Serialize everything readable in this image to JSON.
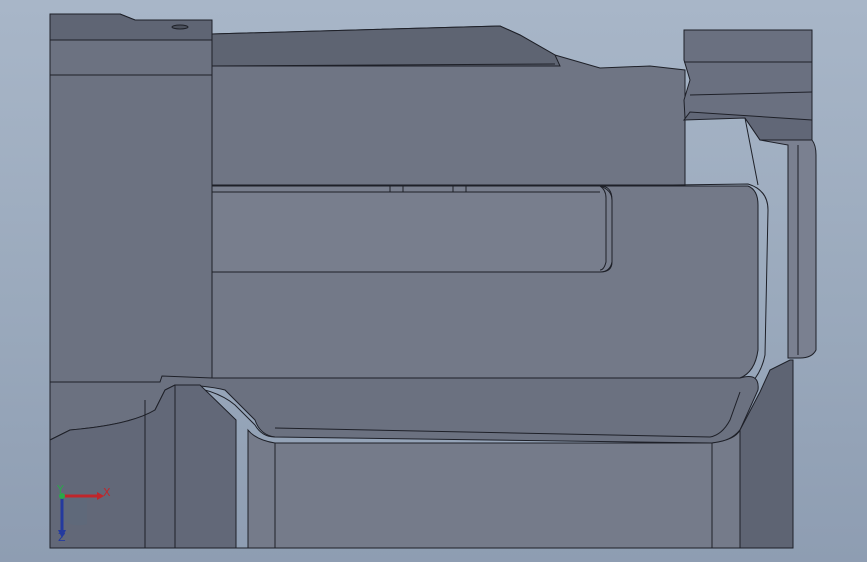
{
  "app": "CAD 3D viewport",
  "viewport": {
    "background_top": "#a8b6c8",
    "background_bottom": "#8e9db2",
    "model_color": "#717786",
    "model_shadow": "#5d6270",
    "model_highlight": "#858b99",
    "edge_color": "#1e2028"
  },
  "triad": {
    "x_label": "X",
    "y_label": "Y",
    "z_label": "Z",
    "x_color": "#c0262b",
    "y_color": "#2aa84a",
    "z_color": "#243a9e"
  }
}
